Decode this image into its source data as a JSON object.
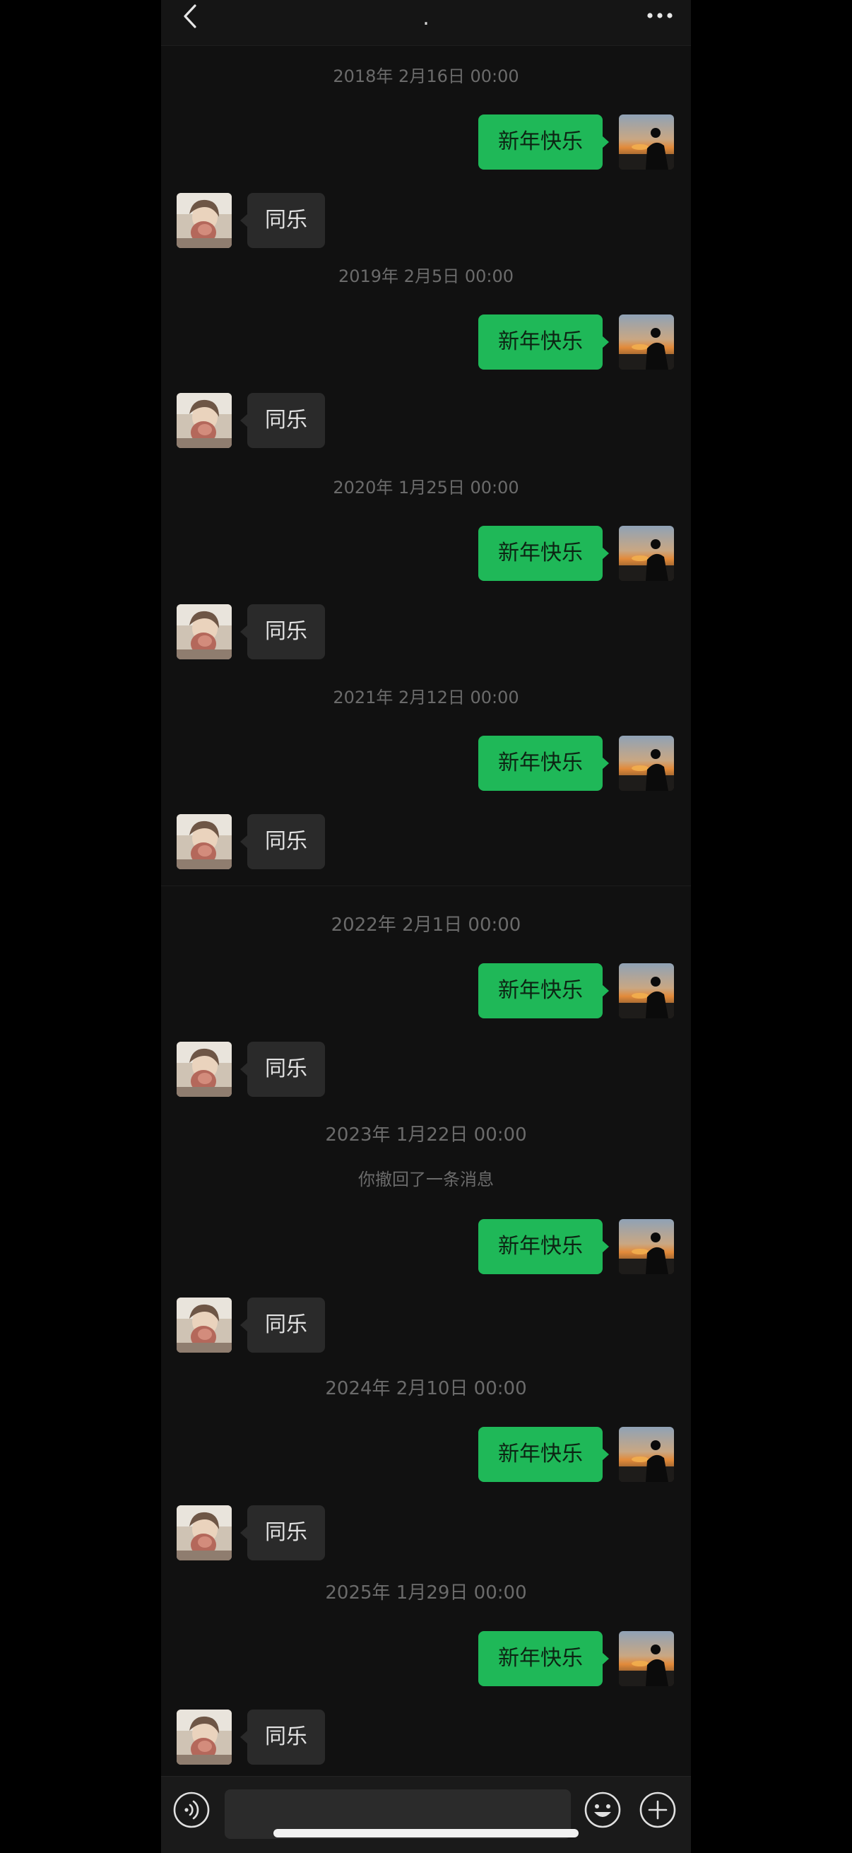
{
  "header": {
    "title": ".",
    "back_icon": "chevron-left-icon",
    "more_icon": "ellipsis-icon"
  },
  "chat": {
    "outgoing_text": "新年快乐",
    "incoming_text": "同乐",
    "recall_notice": "你撤回了一条消息",
    "groups": [
      {
        "timestamp": "2018年 2月16日 00:00"
      },
      {
        "timestamp": "2019年 2月5日 00:00"
      },
      {
        "timestamp": "2020年 1月25日 00:00"
      },
      {
        "timestamp": "2021年 2月12日 00:00"
      },
      {
        "timestamp": "2022年 2月1日 00:00"
      },
      {
        "timestamp": "2023年 1月22日 00:00"
      },
      {
        "timestamp": "2024年 2月10日 00:00"
      },
      {
        "timestamp": "2025年 1月29日 00:00"
      }
    ]
  },
  "input_bar": {
    "voice_icon": "voice-icon",
    "emoji_icon": "emoji-icon",
    "plus_icon": "plus-icon",
    "placeholder": ""
  },
  "colors": {
    "background": "#111111",
    "outgoing_bubble": "#1fb858",
    "incoming_bubble": "#2a2a2a",
    "timestamp_text": "#6b6b6b"
  }
}
